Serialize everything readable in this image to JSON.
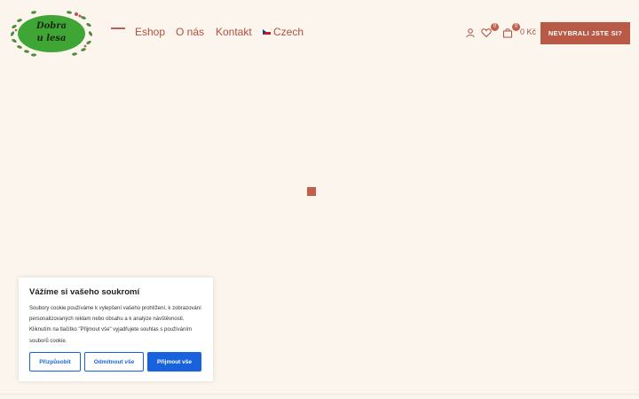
{
  "brand": {
    "logo_line1": "Dobra",
    "logo_line2": "u lesa"
  },
  "nav": {
    "items": [
      {
        "label": "Eshop"
      },
      {
        "label": "O nás"
      },
      {
        "label": "Kontakt"
      },
      {
        "label": "Czech"
      }
    ]
  },
  "header": {
    "wishlist_count": "0",
    "cart_count": "0",
    "cart_total": "0 Kč",
    "cta_label": "NEVYBRALI JSTE SI?"
  },
  "cookie": {
    "title": "Vážíme si vašeho soukromí",
    "text": "Soubory cookie používáme k vylepšení vašeho prohlížení, k zobrazování personalizovaných reklam nebo obsahu a k analýze návštěvnosti. Kliknutím na tlačítko \"Přijmout vše\" vyjadřujete souhlas s používáním souborů cookie.",
    "customize_label": "Přizpůsobit",
    "reject_label": "Odmítnout vše",
    "accept_label": "Přijmout vše"
  },
  "colors": {
    "background": "#fbf5ee",
    "accent": "#b85a46",
    "logo_green": "#3fa535",
    "cookie_blue": "#1863dc"
  }
}
